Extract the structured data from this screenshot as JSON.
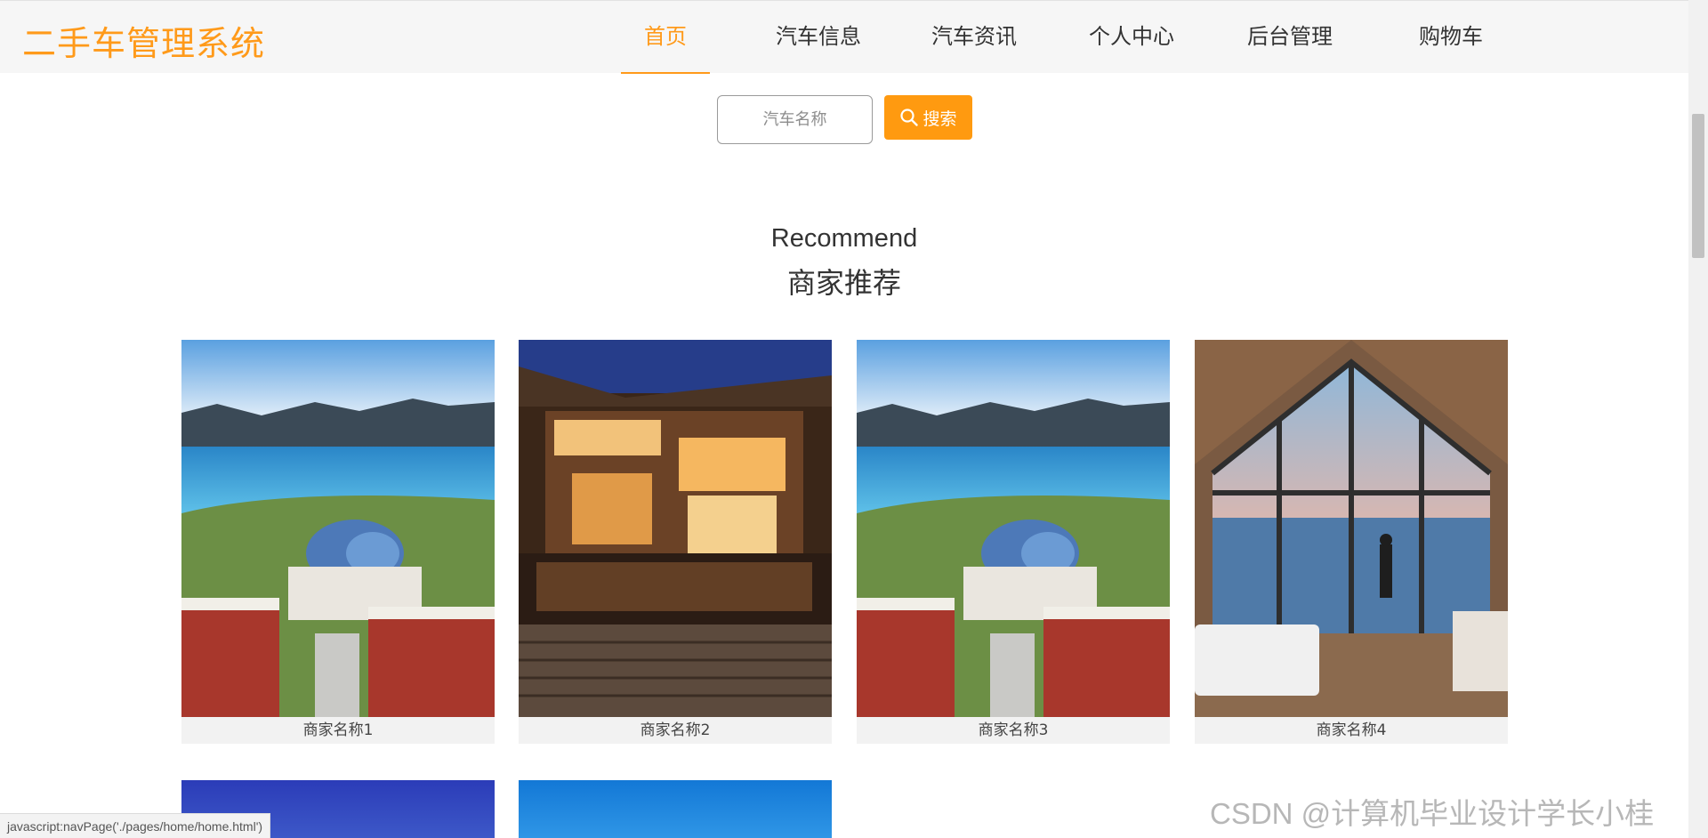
{
  "header": {
    "logo": "二手车管理系统",
    "nav": [
      {
        "label": "首页",
        "active": true
      },
      {
        "label": "汽车信息",
        "active": false
      },
      {
        "label": "汽车资讯",
        "active": false
      },
      {
        "label": "个人中心",
        "active": false
      },
      {
        "label": "后台管理",
        "active": false
      },
      {
        "label": "购物车",
        "active": false
      }
    ]
  },
  "search": {
    "placeholder": "汽车名称",
    "button_label": "搜索",
    "button_icon": "search-icon"
  },
  "section": {
    "title_en": "Recommend",
    "title_cn": "商家推荐"
  },
  "merchants": [
    {
      "name": "商家名称1",
      "image": "campus-lake-domes"
    },
    {
      "name": "商家名称2",
      "image": "wooden-courtyard-night"
    },
    {
      "name": "商家名称3",
      "image": "campus-lake-domes"
    },
    {
      "name": "商家名称4",
      "image": "glass-cabin-lake-view"
    },
    {
      "image": "blue-sky"
    },
    {
      "image": "blue-sky"
    }
  ],
  "status_bar": {
    "url": "javascript:navPage('./pages/home/home.html')"
  },
  "watermark": "CSDN @计算机毕业设计学长小桂",
  "colors": {
    "accent": "#ff9a10",
    "header_bg": "#f6f6f6",
    "caption_bg": "#f2f2f2"
  }
}
